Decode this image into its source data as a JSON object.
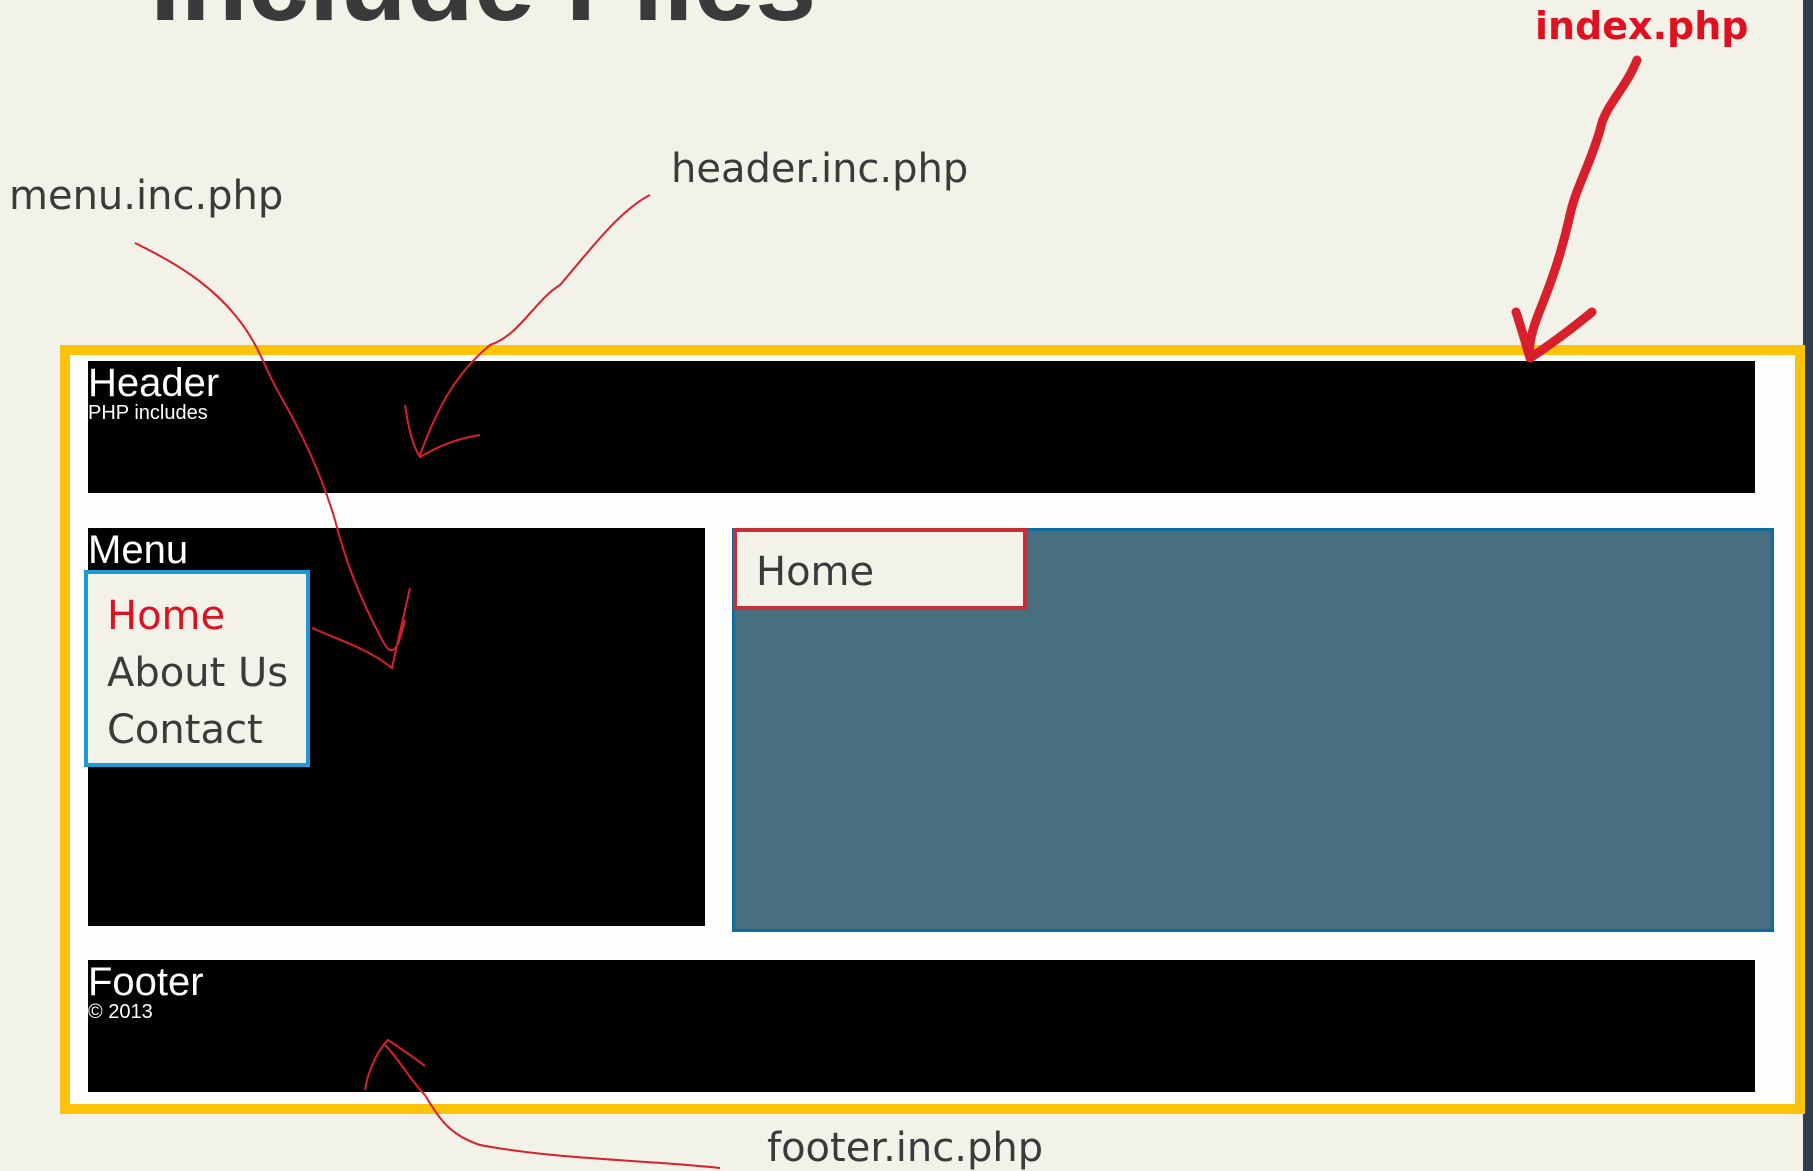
{
  "slide": {
    "title": "Include Files"
  },
  "annotations": {
    "index_label": "index.php",
    "header_label": "header.inc.php",
    "menu_label": "menu.inc.php",
    "footer_label": "footer.inc.php"
  },
  "page_mockup": {
    "header": {
      "title": "Header",
      "subtitle": "PHP includes"
    },
    "menu": {
      "title": "Menu",
      "items": [
        {
          "label": "Home",
          "active": true
        },
        {
          "label": "About Us",
          "active": false
        },
        {
          "label": "Contact",
          "active": false
        }
      ]
    },
    "content": {
      "tab_label": "Home"
    },
    "footer": {
      "title": "Footer",
      "subtitle": "© 2013"
    }
  },
  "colors": {
    "background": "#f3f2e8",
    "frame": "#fcc30a",
    "annotation_red": "#e01020",
    "menu_border": "#1c9ad6",
    "content_fill": "#486f80",
    "content_border": "#0d6da0",
    "tab_border": "#c42f3a"
  }
}
